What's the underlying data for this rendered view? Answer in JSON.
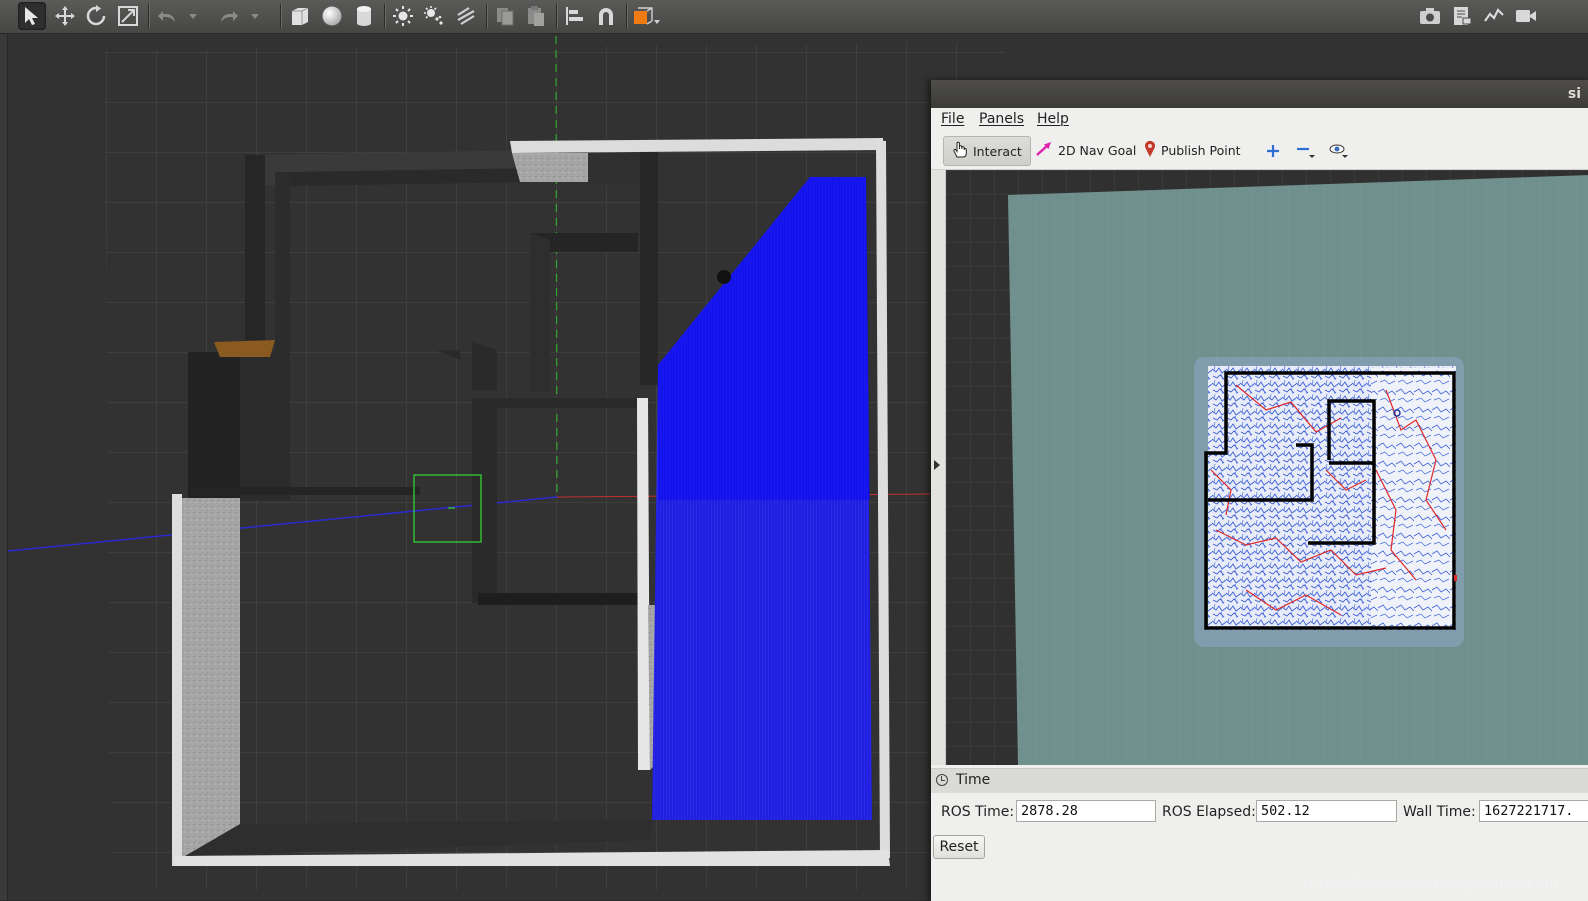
{
  "gazebo": {
    "toolbar_icons": [
      "select-arrow-icon",
      "translate-icon",
      "rotate-icon",
      "scale-icon",
      "undo-icon",
      "undo-dropdown-icon",
      "redo-icon",
      "redo-dropdown-icon",
      "box-icon",
      "sphere-icon",
      "cylinder-icon",
      "point-light-icon",
      "spot-light-icon",
      "directional-light-icon",
      "copy-icon",
      "paste-icon",
      "align-icon",
      "snap-magnet-icon",
      "change-view-icon",
      "screenshot-icon",
      "log-icon",
      "plot-icon",
      "video-record-icon"
    ]
  },
  "rviz": {
    "window_title": "si",
    "menu": [
      "File",
      "Panels",
      "Help"
    ],
    "tools": [
      {
        "label": "Interact",
        "icon": "hand-icon",
        "active": true
      },
      {
        "label": "2D Nav Goal",
        "icon": "nav-goal-arrow-icon",
        "active": false
      },
      {
        "label": "Publish Point",
        "icon": "pin-icon",
        "active": false
      }
    ],
    "view_tools": [
      "plus-icon",
      "minus-icon",
      "eye-icon"
    ],
    "time_panel": {
      "title": "Time",
      "ros_time_label": "ROS Time:",
      "ros_time": "2878.28",
      "ros_elapsed_label": "ROS Elapsed:",
      "ros_elapsed": "502.12",
      "wall_time_label": "Wall Time:",
      "wall_time": "1627221717.",
      "reset_label": "Reset"
    }
  },
  "watermark": "https://blog.csdn.net/gwplovekimi",
  "colors": {
    "laser": "#1a1ae6",
    "map_background": "#6d8f8c",
    "path_red": "#e02828",
    "path_blue": "#2c52d8"
  }
}
